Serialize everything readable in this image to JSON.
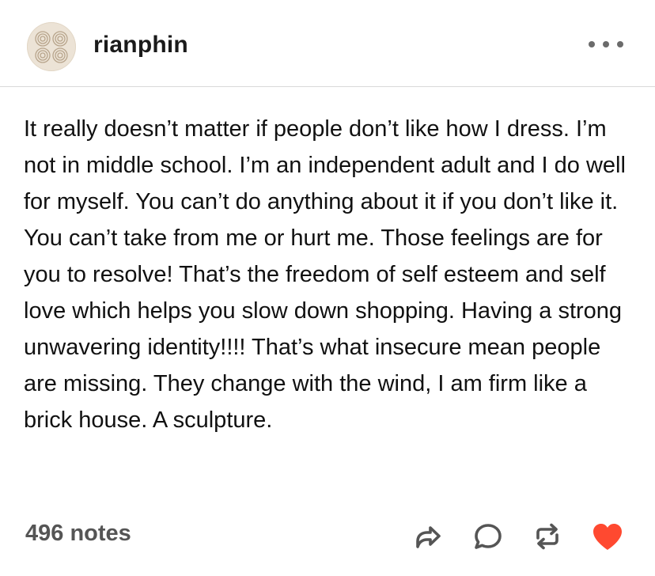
{
  "post": {
    "username": "rianphin",
    "body": "It really doesn’t matter if people don’t like how I dress. I’m not in middle school. I’m an independent adult and I do well for myself. You can’t do anything about it if you don’t like it. You can’t take from me or hurt me. Those feelings are for you to resolve! That’s the freedom of self esteem and self love which helps you slow down shopping. Having a strong unwavering identity!!!! That’s what insecure mean people are missing. They change with the wind, I am firm like a brick house. A sculpture.",
    "notes": "496 notes"
  },
  "icons": {
    "avatar": "avatar-image",
    "more": "more-dots-icon",
    "share": "share-icon",
    "reply": "reply-icon",
    "reblog": "reblog-icon",
    "like": "heart-icon"
  },
  "colors": {
    "like": "#ff4930",
    "icon": "#555555",
    "divider": "#d9d9d9"
  }
}
